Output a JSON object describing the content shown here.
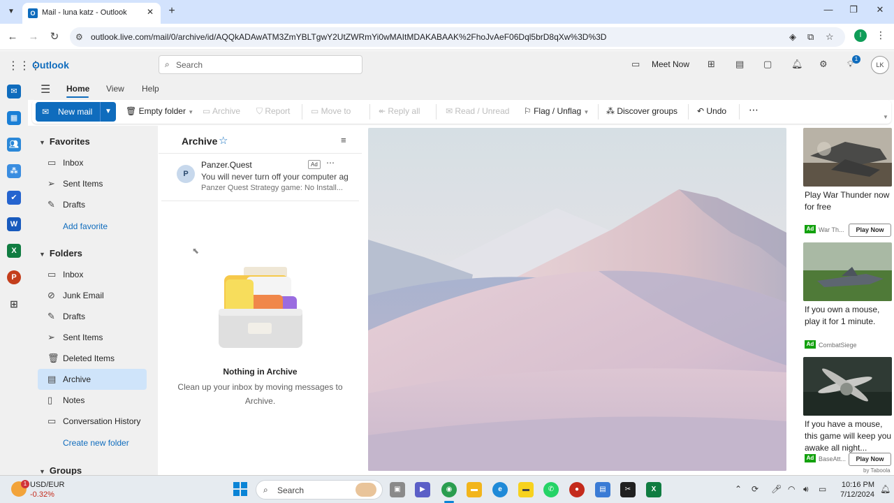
{
  "browser": {
    "tab_title": "Mail - luna katz - Outlook",
    "url": "outlook.live.com/mail/0/archive/id/AQQkADAwATM3ZmYBLTgwY2UtZWRmYi0wMAItMDAKABAAK%2FhoJvAeF06Dql5brD8qXw%3D%3D"
  },
  "outlook": {
    "brand": "Outlook",
    "search_placeholder": "Search",
    "meet_now": "Meet Now",
    "notifications_count": "1",
    "user_initials": "LK"
  },
  "ribbon": {
    "tabs": [
      "Home",
      "View",
      "Help"
    ],
    "new_mail": "New mail",
    "empty_folder": "Empty folder",
    "archive": "Archive",
    "report": "Report",
    "move_to": "Move to",
    "reply_all": "Reply all",
    "read_unread": "Read / Unread",
    "flag_unflag": "Flag / Unflag",
    "discover_groups": "Discover groups",
    "undo": "Undo"
  },
  "folders": {
    "favorites_header": "Favorites",
    "favorites": [
      "Inbox",
      "Sent Items",
      "Drafts"
    ],
    "add_favorite": "Add favorite",
    "folders_header": "Folders",
    "items": [
      "Inbox",
      "Junk Email",
      "Drafts",
      "Sent Items",
      "Deleted Items",
      "Archive",
      "Notes",
      "Conversation History"
    ],
    "selected": "Archive",
    "create_folder": "Create new folder",
    "groups_header": "Groups"
  },
  "message_list": {
    "title": "Archive",
    "ad": {
      "avatar": "P",
      "sender": "Panzer.Quest",
      "badge": "Ad",
      "subject": "You will never turn off your computer again",
      "preview": "Panzer Quest Strategy game: No Install..."
    },
    "empty_title": "Nothing in Archive",
    "empty_desc": "Clean up your inbox by moving messages to Archive."
  },
  "ads": [
    {
      "headline": "Play War Thunder now for free",
      "tag": "Ad",
      "brand": "War Th...",
      "cta": "Play Now"
    },
    {
      "headline": "If you own a mouse, play it for 1 minute.",
      "tag": "Ad",
      "brand": "CombatSiege",
      "cta": ""
    },
    {
      "headline": "If you have a mouse, this game will keep you awake all night...",
      "tag": "Ad",
      "brand": "BaseAtt...",
      "cta": "Play Now"
    }
  ],
  "ads_footer": "by Taboola",
  "taskbar": {
    "ticker_name": "USD/EUR",
    "ticker_change": "-0.32%",
    "weather_badge": "1",
    "search_label": "Search",
    "time": "10:16 PM",
    "date": "7/12/2024"
  },
  "colors": {
    "accent": "#0f6cbd",
    "selected_folder": "#cfe4fa",
    "ad_green": "#13a10e"
  }
}
